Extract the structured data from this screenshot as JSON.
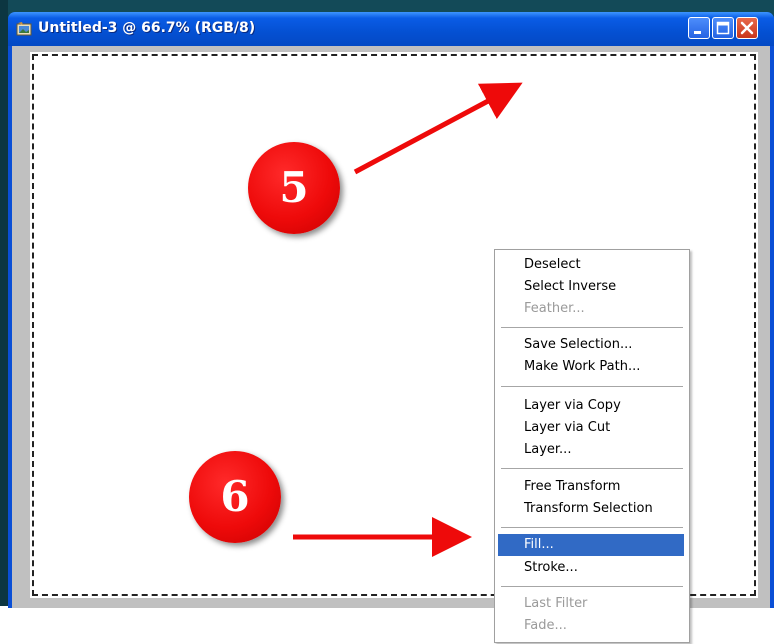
{
  "window": {
    "title": "Untitled-3 @ 66.7% (RGB/8)",
    "app_icon": "photoshop-document-icon",
    "controls": {
      "minimize": "minimize-icon",
      "maximize": "maximize-icon",
      "close": "close-icon"
    }
  },
  "context_menu": {
    "items": [
      {
        "label": "Deselect",
        "enabled": true
      },
      {
        "label": "Select Inverse",
        "enabled": true
      },
      {
        "label": "Feather...",
        "enabled": false
      },
      {
        "label": "Save Selection...",
        "enabled": true
      },
      {
        "label": "Make Work Path...",
        "enabled": true
      },
      {
        "label": "Layer via Copy",
        "enabled": true
      },
      {
        "label": "Layer via Cut",
        "enabled": true
      },
      {
        "label": "Layer...",
        "enabled": true
      },
      {
        "label": "Free Transform",
        "enabled": true
      },
      {
        "label": "Transform Selection",
        "enabled": true
      },
      {
        "label": "Fill...",
        "enabled": true,
        "highlighted": true
      },
      {
        "label": "Stroke...",
        "enabled": true
      },
      {
        "label": "Last Filter",
        "enabled": false
      },
      {
        "label": "Fade...",
        "enabled": false
      }
    ]
  },
  "callouts": [
    {
      "number": "5"
    },
    {
      "number": "6"
    }
  ],
  "colors": {
    "titlebar": "#0450d2",
    "menu_highlight": "#316ac5",
    "callout": "#ee0a0a",
    "arrow": "#ee0a0a",
    "slide_background": "#0f3e4c"
  }
}
